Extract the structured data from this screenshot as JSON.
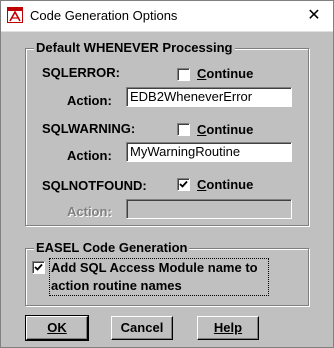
{
  "window": {
    "title": "Code Generation Options",
    "close_glyph": "✕"
  },
  "whenever_group": {
    "title": "Default WHENEVER Processing",
    "sqlerror": {
      "label": "SQLERROR:",
      "continue_label": "Continue",
      "continue_checked": false,
      "action_label": "Action:",
      "action_value": "EDB2WheneverError"
    },
    "sqlwarning": {
      "label": "SQLWARNING:",
      "continue_label": "Continue",
      "continue_checked": false,
      "action_label": "Action:",
      "action_value": "MyWarningRoutine"
    },
    "sqlnotfound": {
      "label": "SQLNOTFOUND:",
      "continue_label": "Continue",
      "continue_checked": true,
      "action_label": "Action:",
      "action_value": ""
    }
  },
  "easel_group": {
    "title": "EASEL Code Generation",
    "add_module_label_line1": "Add SQL Access Module name to",
    "add_module_label_line2": "action routine names",
    "add_module_checked": true
  },
  "buttons": {
    "ok": "OK",
    "cancel": "Cancel",
    "help": "Help"
  },
  "icons": {
    "app": "easel-app-icon",
    "check": "checkmark-icon"
  }
}
